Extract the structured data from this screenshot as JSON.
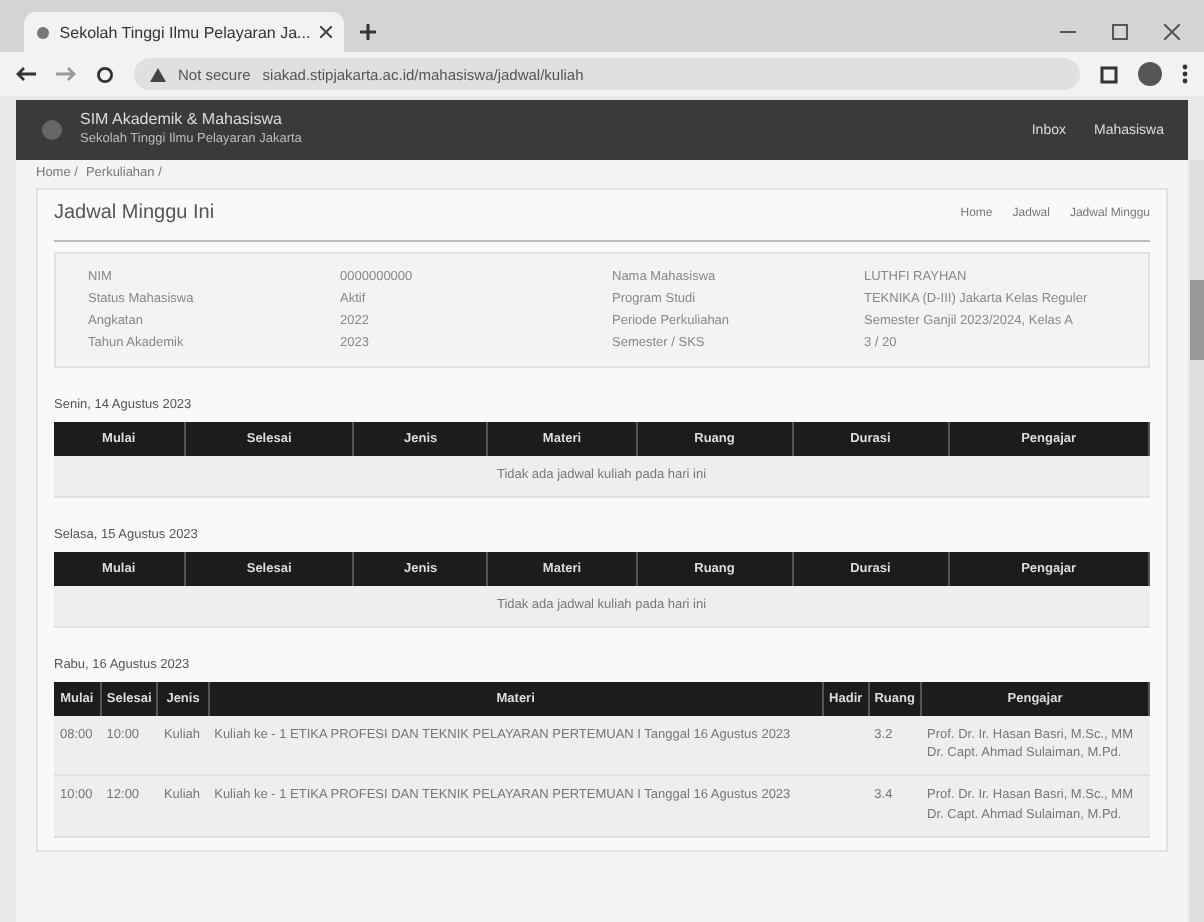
{
  "browser": {
    "tab_title": "Sekolah Tinggi Ilmu Pelayaran Ja...",
    "url_warning": "Not secure",
    "url": "siakad.stipjakarta.ac.id/mahasiswa/jadwal/kuliah"
  },
  "header": {
    "title": "SIM Akademik & Mahasiswa",
    "subtitle": "Sekolah Tinggi Ilmu Pelayaran Jakarta",
    "links": [
      "Inbox",
      "Mahasiswa"
    ]
  },
  "breadcrumb": [
    "Home /",
    "Perkuliahan /"
  ],
  "page": {
    "title": "Jadwal Minggu Ini",
    "actions": [
      "Home",
      "Jadwal",
      "Jadwal Minggu"
    ]
  },
  "info": [
    {
      "label": "NIM",
      "value": "0000000000"
    },
    {
      "label": "Nama Mahasiswa",
      "value": "LUTHFI RAYHAN"
    },
    {
      "label": "Status Mahasiswa",
      "value": "Aktif"
    },
    {
      "label": "Program Studi",
      "value": "TEKNIKA (D-III) Jakarta Kelas Reguler"
    },
    {
      "label": "Angkatan",
      "value": "2022"
    },
    {
      "label": "Periode Perkuliahan",
      "value": "Semester Ganjil 2023/2024, Kelas A"
    },
    {
      "label": "Tahun Akademik",
      "value": "2023"
    },
    {
      "label": "Semester / SKS",
      "value": "3 / 20"
    }
  ],
  "days": [
    {
      "title": "Senin, 14 Agustus 2023",
      "columns": [
        "Mulai",
        "Selesai",
        "Jenis",
        "Materi",
        "Ruang",
        "Durasi",
        "Pengajar"
      ],
      "empty": "Tidak ada jadwal kuliah pada hari ini"
    },
    {
      "title": "Selasa, 15 Agustus 2023",
      "columns": [
        "Mulai",
        "Selesai",
        "Jenis",
        "Materi",
        "Ruang",
        "Durasi",
        "Pengajar"
      ],
      "empty": "Tidak ada jadwal kuliah pada hari ini"
    },
    {
      "title": "Rabu, 16 Agustus 2023",
      "columns": [
        "Mulai",
        "Selesai",
        "Jenis",
        "Materi",
        "Hadir",
        "Ruang",
        "Pengajar"
      ],
      "rows": [
        [
          "08:00",
          "10:00",
          "Kuliah",
          "Kuliah ke - 1 ETIKA PROFESI DAN TEKNIK PELAYARAN PERTEMUAN I Tanggal 16 Agustus 2023",
          "",
          "3.2",
          "Prof. Dr. Ir. Hasan Basri, M.Sc., MM\nDr. Capt. Ahmad Sulaiman, M.Pd."
        ],
        [
          "10:00",
          "12:00",
          "Kuliah",
          "Kuliah ke - 1 ETIKA PROFESI DAN TEKNIK PELAYARAN PERTEMUAN I Tanggal 16 Agustus 2023",
          "",
          "3.4",
          "Prof. Dr. Ir. Hasan Basri, M.Sc., MM\nDr. Capt. Ahmad Sulaiman, M.Pd."
        ]
      ]
    }
  ]
}
